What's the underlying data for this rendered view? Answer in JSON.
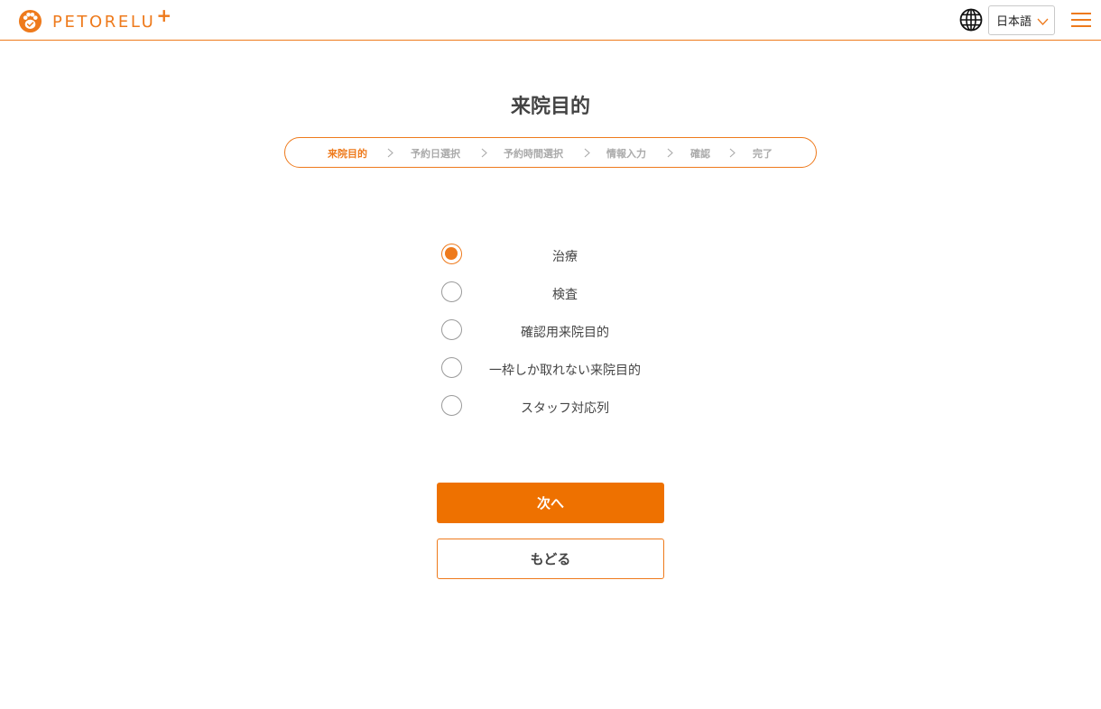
{
  "header": {
    "brand": "PETORELU",
    "brand_plus": "+",
    "language": "日本語",
    "icons": [
      "paw-logo-icon",
      "globe-icon",
      "chevron-down-icon",
      "hamburger-menu-icon"
    ]
  },
  "page": {
    "title": "来院目的"
  },
  "steps": [
    {
      "label": "来院目的",
      "active": true
    },
    {
      "label": "予約日選択",
      "active": false
    },
    {
      "label": "予約時間選択",
      "active": false
    },
    {
      "label": "情報入力",
      "active": false
    },
    {
      "label": "確認",
      "active": false
    },
    {
      "label": "完了",
      "active": false
    }
  ],
  "purposes": [
    {
      "label": "治療",
      "selected": true
    },
    {
      "label": "検査",
      "selected": false
    },
    {
      "label": "確認用来院目的",
      "selected": false
    },
    {
      "label": "一枠しか取れない来院目的",
      "selected": false
    },
    {
      "label": "スタッフ対応列",
      "selected": false
    }
  ],
  "actions": {
    "next": "次へ",
    "back": "もどる"
  },
  "colors": {
    "accent": "#ee7a1c",
    "button": "#ee7100",
    "text": "#444444",
    "inactive_step": "#aaaaaa"
  }
}
